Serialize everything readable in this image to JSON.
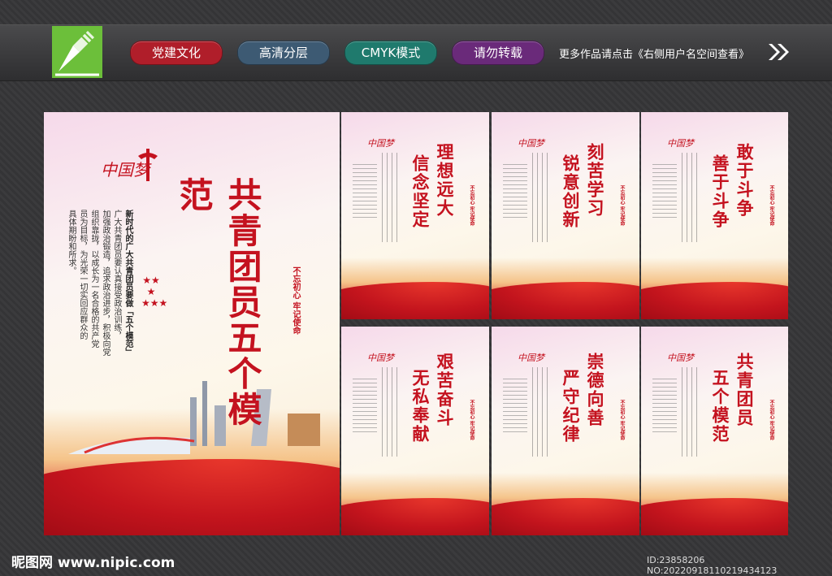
{
  "header": {
    "tags": [
      {
        "label": "党建文化",
        "color": "#b01e2a"
      },
      {
        "label": "高清分层",
        "color": "#3d5a73"
      },
      {
        "label": "CMYK模式",
        "color": "#1f7a6d"
      },
      {
        "label": "请勿转载",
        "color": "#6a2a7a"
      }
    ],
    "more_text": "更多作品请点击《右侧用户名空间查看》"
  },
  "main_poster": {
    "logo_text": "中国梦",
    "title": "共青团员五个模范",
    "seal": "不忘初心 牢记使命",
    "body_lines": [
      "新时代的广大共青团员要做「五个模范」",
      "广大共青团员要认真接受政治训练，",
      "加强政治锻造，追求政治进步，积极向党",
      "组织靠拢，以成长为一名合格的共产党",
      "员为目标，为光荣一切实回应群众的",
      "具体期盼和所求。"
    ]
  },
  "small_posters": [
    {
      "title_1": "理想远大",
      "title_2": "信念坚定"
    },
    {
      "title_1": "刻苦学习",
      "title_2": "锐意创新"
    },
    {
      "title_1": "敢于斗争",
      "title_2": "善于斗争"
    },
    {
      "title_1": "艰苦奋斗",
      "title_2": "无私奉献"
    },
    {
      "title_1": "崇德向善",
      "title_2": "严守纪律"
    },
    {
      "title_1": "共青团员",
      "title_2": "五个模范"
    }
  ],
  "small_seal": "不忘初心 牢记使命",
  "small_logo_text": "中国梦",
  "footer": {
    "site": "昵图网 www.nipic.com",
    "id_text": "ID:23858206 NO:20220918110219434123"
  },
  "colors": {
    "accent": "#c4121f",
    "logo_green": "#6cbf3a"
  }
}
